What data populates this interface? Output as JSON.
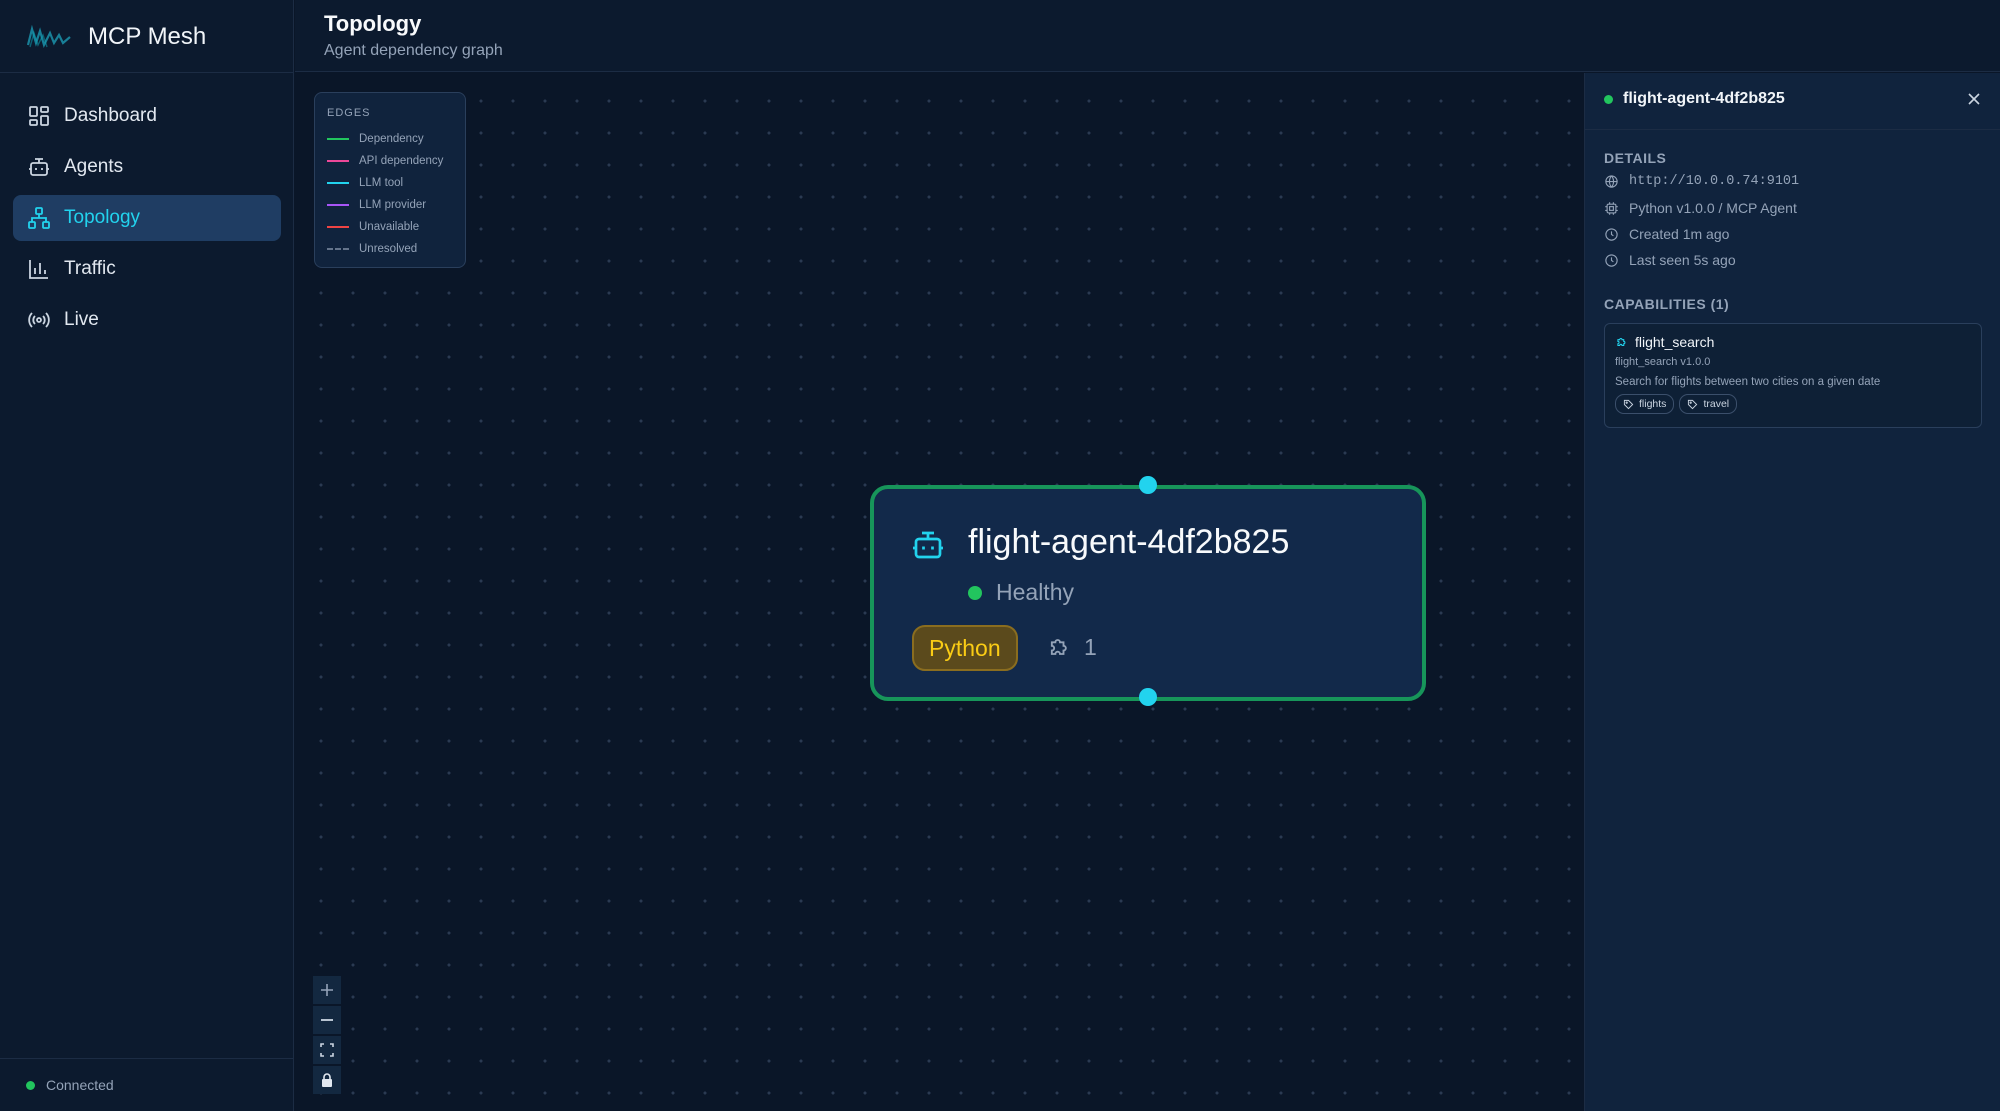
{
  "app": {
    "title": "MCP Mesh"
  },
  "sidebar": {
    "items": [
      {
        "label": "Dashboard",
        "icon": "dashboard-icon",
        "active": false
      },
      {
        "label": "Agents",
        "icon": "robot-icon",
        "active": false
      },
      {
        "label": "Topology",
        "icon": "topology-icon",
        "active": true
      },
      {
        "label": "Traffic",
        "icon": "bar-chart-icon",
        "active": false
      },
      {
        "label": "Live",
        "icon": "broadcast-icon",
        "active": false
      }
    ],
    "status": "Connected"
  },
  "header": {
    "title": "Topology",
    "subtitle": "Agent dependency graph"
  },
  "legend": {
    "title": "EDGES",
    "items": [
      {
        "label": "Dependency",
        "color": "#22c55e"
      },
      {
        "label": "API dependency",
        "color": "#ec4899"
      },
      {
        "label": "LLM tool",
        "color": "#22d3ee"
      },
      {
        "label": "LLM provider",
        "color": "#a855f7"
      },
      {
        "label": "Unavailable",
        "color": "#ef4444"
      },
      {
        "label": "Unresolved",
        "color": "#64748b"
      }
    ]
  },
  "zoom_controls": [
    "zoom-in",
    "zoom-out",
    "fit-view",
    "lock"
  ],
  "node": {
    "name": "flight-agent-4df2b825",
    "status": "Healthy",
    "runtime": "Python",
    "capability_count": "1",
    "border_color": "#17955a"
  },
  "panel": {
    "title": "flight-agent-4df2b825",
    "details_title": "DETAILS",
    "endpoint": "http://10.0.0.74:9101",
    "runtime": "Python v1.0.0 / MCP Agent",
    "created": "Created 1m ago",
    "last_seen": "Last seen 5s ago",
    "capabilities_title": "CAPABILITIES (1)",
    "capabilities": [
      {
        "name": "flight_search",
        "version": "flight_search v1.0.0",
        "description": "Search for flights between two cities on a given date",
        "tags": [
          "flights",
          "travel"
        ]
      }
    ]
  },
  "colors": {
    "accent": "#22d3ee",
    "healthy": "#22c55e",
    "python": "#facc15"
  }
}
